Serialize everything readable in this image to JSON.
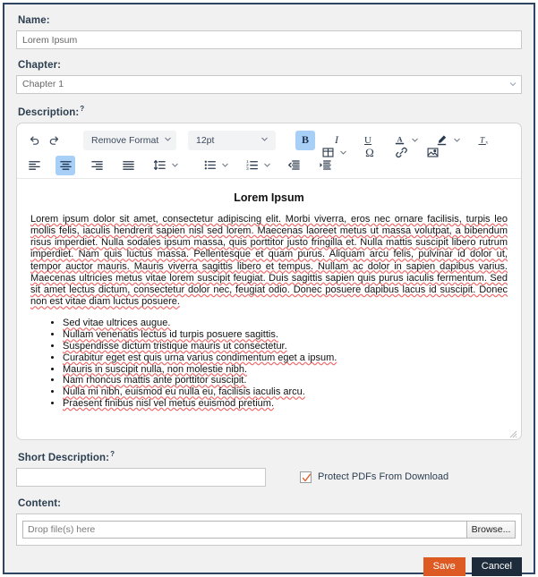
{
  "form": {
    "name": {
      "label": "Name:",
      "value": "Lorem Ipsum"
    },
    "chapter": {
      "label": "Chapter:",
      "value": "Chapter 1",
      "caret_icon": "chevron-down-icon"
    },
    "description": {
      "label": "Description:",
      "help": "?"
    },
    "short_description": {
      "label": "Short Description:",
      "help": "?",
      "value": ""
    },
    "content": {
      "label": "Content:",
      "drop_text": "Drop file(s) here",
      "browse_label": "Browse..."
    },
    "protect_checkbox": {
      "label": "Protect PDFs From Download",
      "checked": true,
      "check_color": "#dd5b22"
    }
  },
  "editor": {
    "toolbar_row1": {
      "undo": {
        "name": "undo-icon",
        "title": "Undo"
      },
      "redo": {
        "name": "redo-icon",
        "title": "Redo"
      },
      "format_select": {
        "label": "Remove Format",
        "caret": "chevron-down-icon"
      },
      "fontsize_select": {
        "label": "12pt",
        "caret": "chevron-down-icon"
      },
      "bold": {
        "label": "B",
        "active": true
      },
      "italic": {
        "label": "I",
        "active": false
      },
      "underline": {
        "label": "U",
        "active": false
      },
      "font_color": {
        "label": "A",
        "caret": "chevron-down-icon"
      },
      "highlight": {
        "name": "highlighter-icon",
        "caret": "chevron-down-icon"
      },
      "clear_format": {
        "label": "Tx"
      }
    },
    "toolbar_row2": {
      "align_left": {
        "name": "align-left-icon",
        "active": false
      },
      "align_center": {
        "name": "align-center-icon",
        "active": true
      },
      "align_right": {
        "name": "align-right-icon",
        "active": false
      },
      "align_justify": {
        "name": "align-justify-icon",
        "active": false
      },
      "line_height": {
        "name": "line-height-icon",
        "caret": "chevron-down-icon"
      },
      "bullet_list": {
        "name": "bullet-list-icon",
        "caret": "chevron-down-icon"
      },
      "numbered_list": {
        "name": "numbered-list-icon",
        "caret": "chevron-down-icon"
      },
      "outdent": {
        "name": "outdent-icon"
      },
      "indent": {
        "name": "indent-icon"
      },
      "table": {
        "name": "table-icon",
        "caret": "chevron-down-icon"
      },
      "special_char": {
        "label": "Ω"
      },
      "link": {
        "name": "link-icon"
      },
      "image": {
        "name": "image-icon"
      }
    },
    "document": {
      "title": "Lorem Ipsum",
      "paragraphs": [
        "Lorem ipsum dolor sit amet, consectetur adipiscing elit. Morbi viverra, eros nec ornare facilisis, turpis leo mollis felis, iaculis hendrerit sapien nisl sed lorem. Maecenas laoreet metus ut massa volutpat, a bibendum risus imperdiet. Nulla sodales ipsum massa, quis porttitor justo fringilla et. Nulla mattis suscipit libero rutrum imperdiet. Nam quis luctus massa. Pellentesque et quam purus. Aliquam arcu felis, pulvinar id dolor ut, tempor auctor mauris. Mauris viverra sagittis libero et tempus. Nullam ac dolor in sapien dapibus varius. Maecenas ultricies metus vitae lorem suscipit feugiat. Duis sagittis sapien quis purus iaculis fermentum. Sed sit amet lectus dictum, consectetur dolor nec, feugiat odio. Donec posuere dapibus lacus id suscipit. Donec non est vitae diam luctus posuere."
      ],
      "bullets": [
        "Sed vitae ultrices augue.",
        "Nullam venenatis lectus id turpis posuere sagittis.",
        "Suspendisse dictum tristique mauris ut consectetur.",
        "Curabitur eget est quis urna varius condimentum eget a ipsum.",
        "Mauris in suscipit nulla, non molestie nibh.",
        "Nam rhoncus mattis ante porttitor suscipit.",
        "Nulla mi nibh, euismod eu nulla eu, facilisis iaculis arcu.",
        "Praesent finibus nisl vel metus euismod pretium."
      ]
    },
    "resize_handle": "resize-grip-icon"
  },
  "actions": {
    "save": {
      "label": "Save",
      "color": "#dd5b22"
    },
    "cancel": {
      "label": "Cancel",
      "color": "#1d2b3a"
    }
  }
}
